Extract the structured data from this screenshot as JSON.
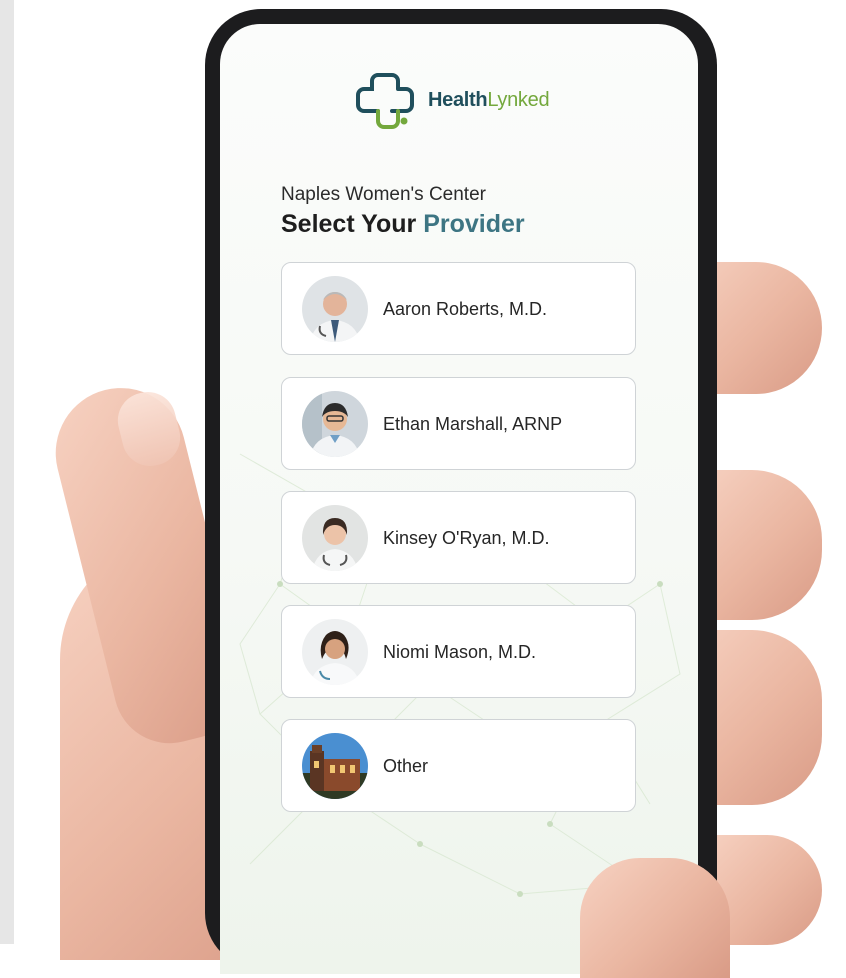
{
  "app": {
    "logo": {
      "text_bold": "Health",
      "text_light": "Lynked",
      "icon": "healthlynked-cross-logo"
    }
  },
  "page": {
    "clinic_name": "Naples Women's Center",
    "heading_prefix": "Select Your",
    "heading_accent": "Provider"
  },
  "providers": [
    {
      "name": "Aaron Roberts, M.D.",
      "icon": "doctor-photo"
    },
    {
      "name": "Ethan Marshall, ARNP",
      "icon": "doctor-photo"
    },
    {
      "name": "Kinsey O'Ryan, M.D.",
      "icon": "doctor-photo"
    },
    {
      "name": "Niomi Mason, M.D.",
      "icon": "doctor-photo"
    },
    {
      "name": "Other",
      "icon": "building-photo"
    }
  ],
  "colors": {
    "brand_teal": "#1f4f5c",
    "brand_green": "#73a83c",
    "heading_accent": "#3d7583",
    "phone_frame": "#1c1c1e"
  }
}
